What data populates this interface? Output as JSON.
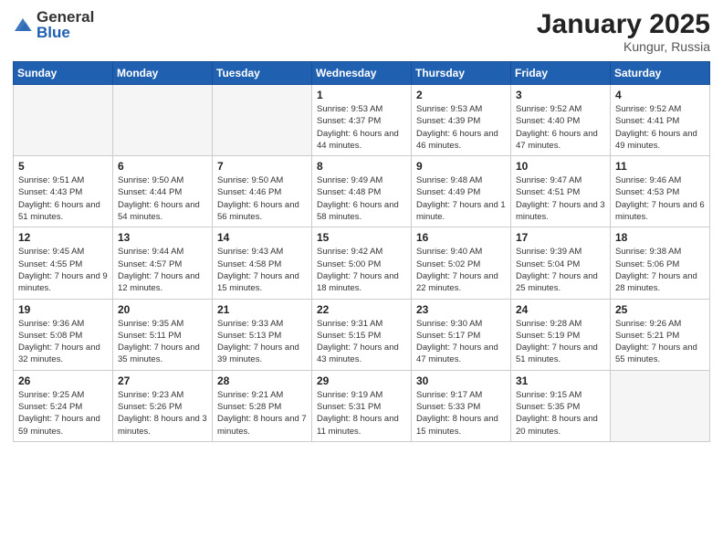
{
  "logo": {
    "general": "General",
    "blue": "Blue"
  },
  "title": "January 2025",
  "subtitle": "Kungur, Russia",
  "weekdays": [
    "Sunday",
    "Monday",
    "Tuesday",
    "Wednesday",
    "Thursday",
    "Friday",
    "Saturday"
  ],
  "weeks": [
    [
      {
        "day": "",
        "empty": true
      },
      {
        "day": "",
        "empty": true
      },
      {
        "day": "",
        "empty": true
      },
      {
        "day": "1",
        "sunrise": "Sunrise: 9:53 AM",
        "sunset": "Sunset: 4:37 PM",
        "daylight": "Daylight: 6 hours and 44 minutes."
      },
      {
        "day": "2",
        "sunrise": "Sunrise: 9:53 AM",
        "sunset": "Sunset: 4:39 PM",
        "daylight": "Daylight: 6 hours and 46 minutes."
      },
      {
        "day": "3",
        "sunrise": "Sunrise: 9:52 AM",
        "sunset": "Sunset: 4:40 PM",
        "daylight": "Daylight: 6 hours and 47 minutes."
      },
      {
        "day": "4",
        "sunrise": "Sunrise: 9:52 AM",
        "sunset": "Sunset: 4:41 PM",
        "daylight": "Daylight: 6 hours and 49 minutes."
      }
    ],
    [
      {
        "day": "5",
        "sunrise": "Sunrise: 9:51 AM",
        "sunset": "Sunset: 4:43 PM",
        "daylight": "Daylight: 6 hours and 51 minutes."
      },
      {
        "day": "6",
        "sunrise": "Sunrise: 9:50 AM",
        "sunset": "Sunset: 4:44 PM",
        "daylight": "Daylight: 6 hours and 54 minutes."
      },
      {
        "day": "7",
        "sunrise": "Sunrise: 9:50 AM",
        "sunset": "Sunset: 4:46 PM",
        "daylight": "Daylight: 6 hours and 56 minutes."
      },
      {
        "day": "8",
        "sunrise": "Sunrise: 9:49 AM",
        "sunset": "Sunset: 4:48 PM",
        "daylight": "Daylight: 6 hours and 58 minutes."
      },
      {
        "day": "9",
        "sunrise": "Sunrise: 9:48 AM",
        "sunset": "Sunset: 4:49 PM",
        "daylight": "Daylight: 7 hours and 1 minute."
      },
      {
        "day": "10",
        "sunrise": "Sunrise: 9:47 AM",
        "sunset": "Sunset: 4:51 PM",
        "daylight": "Daylight: 7 hours and 3 minutes."
      },
      {
        "day": "11",
        "sunrise": "Sunrise: 9:46 AM",
        "sunset": "Sunset: 4:53 PM",
        "daylight": "Daylight: 7 hours and 6 minutes."
      }
    ],
    [
      {
        "day": "12",
        "sunrise": "Sunrise: 9:45 AM",
        "sunset": "Sunset: 4:55 PM",
        "daylight": "Daylight: 7 hours and 9 minutes."
      },
      {
        "day": "13",
        "sunrise": "Sunrise: 9:44 AM",
        "sunset": "Sunset: 4:57 PM",
        "daylight": "Daylight: 7 hours and 12 minutes."
      },
      {
        "day": "14",
        "sunrise": "Sunrise: 9:43 AM",
        "sunset": "Sunset: 4:58 PM",
        "daylight": "Daylight: 7 hours and 15 minutes."
      },
      {
        "day": "15",
        "sunrise": "Sunrise: 9:42 AM",
        "sunset": "Sunset: 5:00 PM",
        "daylight": "Daylight: 7 hours and 18 minutes."
      },
      {
        "day": "16",
        "sunrise": "Sunrise: 9:40 AM",
        "sunset": "Sunset: 5:02 PM",
        "daylight": "Daylight: 7 hours and 22 minutes."
      },
      {
        "day": "17",
        "sunrise": "Sunrise: 9:39 AM",
        "sunset": "Sunset: 5:04 PM",
        "daylight": "Daylight: 7 hours and 25 minutes."
      },
      {
        "day": "18",
        "sunrise": "Sunrise: 9:38 AM",
        "sunset": "Sunset: 5:06 PM",
        "daylight": "Daylight: 7 hours and 28 minutes."
      }
    ],
    [
      {
        "day": "19",
        "sunrise": "Sunrise: 9:36 AM",
        "sunset": "Sunset: 5:08 PM",
        "daylight": "Daylight: 7 hours and 32 minutes."
      },
      {
        "day": "20",
        "sunrise": "Sunrise: 9:35 AM",
        "sunset": "Sunset: 5:11 PM",
        "daylight": "Daylight: 7 hours and 35 minutes."
      },
      {
        "day": "21",
        "sunrise": "Sunrise: 9:33 AM",
        "sunset": "Sunset: 5:13 PM",
        "daylight": "Daylight: 7 hours and 39 minutes."
      },
      {
        "day": "22",
        "sunrise": "Sunrise: 9:31 AM",
        "sunset": "Sunset: 5:15 PM",
        "daylight": "Daylight: 7 hours and 43 minutes."
      },
      {
        "day": "23",
        "sunrise": "Sunrise: 9:30 AM",
        "sunset": "Sunset: 5:17 PM",
        "daylight": "Daylight: 7 hours and 47 minutes."
      },
      {
        "day": "24",
        "sunrise": "Sunrise: 9:28 AM",
        "sunset": "Sunset: 5:19 PM",
        "daylight": "Daylight: 7 hours and 51 minutes."
      },
      {
        "day": "25",
        "sunrise": "Sunrise: 9:26 AM",
        "sunset": "Sunset: 5:21 PM",
        "daylight": "Daylight: 7 hours and 55 minutes."
      }
    ],
    [
      {
        "day": "26",
        "sunrise": "Sunrise: 9:25 AM",
        "sunset": "Sunset: 5:24 PM",
        "daylight": "Daylight: 7 hours and 59 minutes."
      },
      {
        "day": "27",
        "sunrise": "Sunrise: 9:23 AM",
        "sunset": "Sunset: 5:26 PM",
        "daylight": "Daylight: 8 hours and 3 minutes."
      },
      {
        "day": "28",
        "sunrise": "Sunrise: 9:21 AM",
        "sunset": "Sunset: 5:28 PM",
        "daylight": "Daylight: 8 hours and 7 minutes."
      },
      {
        "day": "29",
        "sunrise": "Sunrise: 9:19 AM",
        "sunset": "Sunset: 5:31 PM",
        "daylight": "Daylight: 8 hours and 11 minutes."
      },
      {
        "day": "30",
        "sunrise": "Sunrise: 9:17 AM",
        "sunset": "Sunset: 5:33 PM",
        "daylight": "Daylight: 8 hours and 15 minutes."
      },
      {
        "day": "31",
        "sunrise": "Sunrise: 9:15 AM",
        "sunset": "Sunset: 5:35 PM",
        "daylight": "Daylight: 8 hours and 20 minutes."
      },
      {
        "day": "",
        "empty": true
      }
    ]
  ]
}
